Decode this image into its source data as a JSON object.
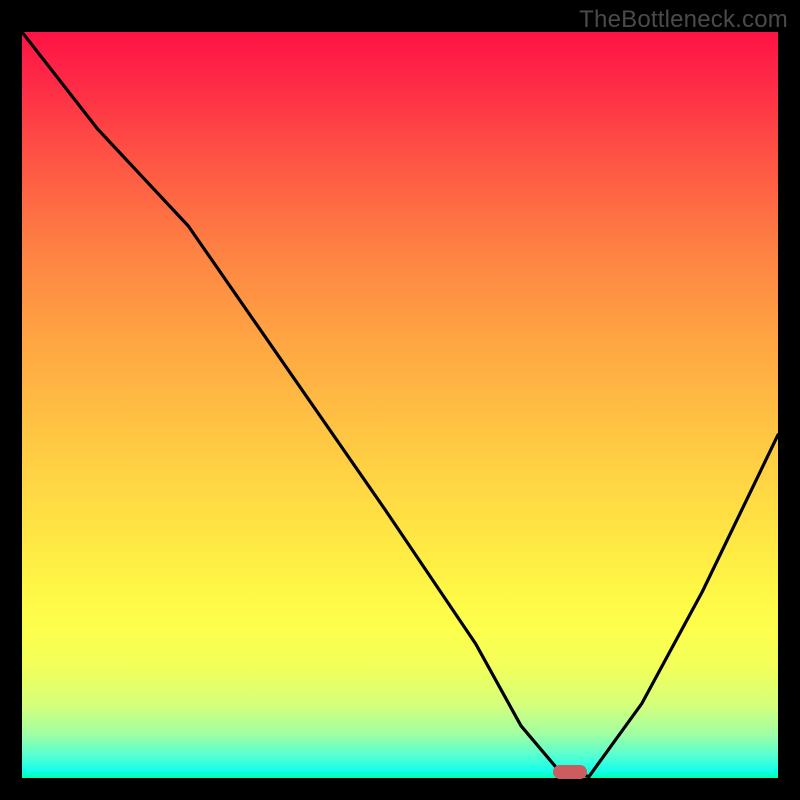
{
  "watermark": "TheBottleneck.com",
  "chart_data": {
    "type": "line",
    "title": "",
    "xlabel": "",
    "ylabel": "",
    "xlim": [
      0,
      100
    ],
    "ylim": [
      0,
      100
    ],
    "grid": false,
    "series": [
      {
        "name": "bottleneck-curve",
        "x": [
          0,
          10,
          22,
          35,
          48,
          60,
          66,
          71,
          75,
          82,
          90,
          100
        ],
        "values": [
          100,
          87,
          74,
          55,
          36,
          18,
          7,
          1,
          0.2,
          10,
          25,
          46
        ]
      }
    ],
    "marker": {
      "x": 72.5,
      "y": 0.8
    },
    "background_gradient": {
      "top": "#fe1345",
      "middle": "#ffe044",
      "bottom": "#00ffaf"
    }
  }
}
